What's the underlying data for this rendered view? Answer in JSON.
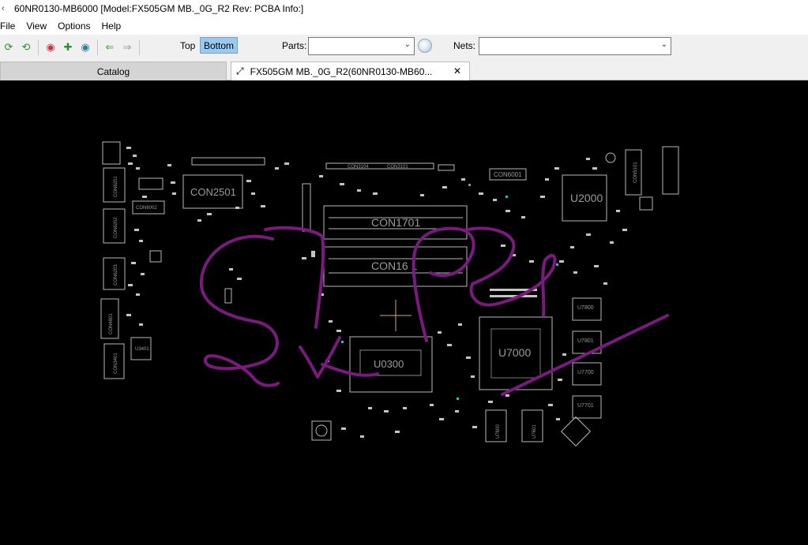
{
  "window": {
    "title": "60NR0130-MB6000 [Model:FX505GM MB._0G_R2 Rev: PCBA Info:]"
  },
  "menu": [
    "File",
    "View",
    "Options",
    "Help"
  ],
  "toolbar": {
    "side_top": "Top",
    "side_bottom": "Bottom",
    "parts_label": "Parts:",
    "parts_value": "",
    "nets_label": "Nets:",
    "nets_value": ""
  },
  "tabs": {
    "catalog": "Catalog",
    "board": "FX505GM MB._0G_R2(60NR0130-MB60..."
  },
  "board": {
    "components": {
      "con2501": "CON2501",
      "con1701": "CON1701",
      "con1601": "CON16 1",
      "u0300": "U0300",
      "u7000": "U7000",
      "u2000": "U2000",
      "con6001": "CON6001",
      "con3104": "CON3104",
      "con3101": "CON3101",
      "con5101": "CON5101",
      "con6201": "CON6201",
      "con6002": "CON6002",
      "con6202": "CON6202",
      "con6203": "CON6203",
      "con4801": "CON4801",
      "con3401": "CON3401",
      "u3401": "U3401",
      "u7800": "U7800",
      "u7801": "U7801",
      "u7700": "U7700",
      "u7701": "U7701",
      "u7600": "U7600",
      "u7601": "U7601"
    }
  },
  "colors": {
    "board_background": "#000000",
    "component_outline": "#b8b8b8",
    "annotation_ink": "#7a1a7e",
    "cursor": "#d9a08a",
    "active_side": "#99c8f0"
  }
}
